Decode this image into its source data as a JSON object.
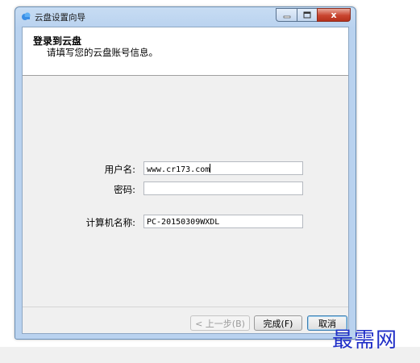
{
  "window": {
    "title": "云盘设置向导",
    "close_symbol": "x"
  },
  "header": {
    "title": "登录到云盘",
    "subtitle": "请填写您的云盘账号信息。"
  },
  "form": {
    "username": {
      "label": "用户名:",
      "value": "www.cr173.com"
    },
    "password": {
      "label": "密码:",
      "value": ""
    },
    "computer_name": {
      "label": "计算机名称:",
      "value": "PC-20150309WXDL"
    }
  },
  "buttons": {
    "back": "< 上一步(B)",
    "finish": "完成(F)",
    "cancel": "取消"
  },
  "watermark": "最需网"
}
